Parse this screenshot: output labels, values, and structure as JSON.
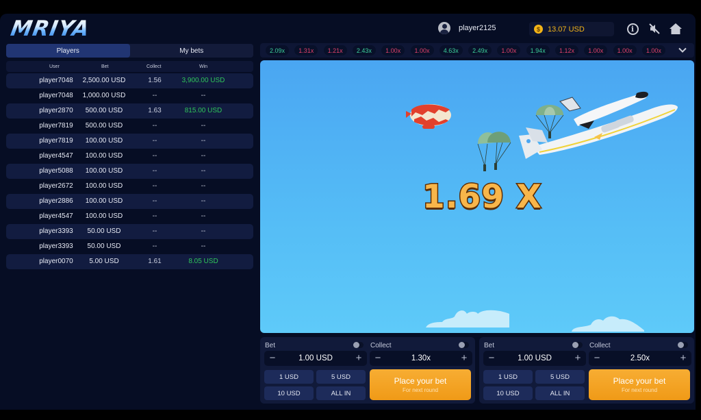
{
  "header": {
    "logo": "MRIYA",
    "username": "player2125",
    "balance": "13.07 USD",
    "icons": [
      "user-avatar-icon",
      "coin-icon",
      "info-icon",
      "sound-muted-icon",
      "home-icon"
    ]
  },
  "left_panel": {
    "tabs": [
      {
        "label": "Players",
        "active": true
      },
      {
        "label": "My bets",
        "active": false
      }
    ],
    "columns": [
      "User",
      "Bet",
      "Collect",
      "Win"
    ],
    "rows": [
      {
        "user": "player7048",
        "bet": "2,500.00 USD",
        "collect": "1.56",
        "win": "3,900.00 USD",
        "won": true
      },
      {
        "user": "player7048",
        "bet": "1,000.00 USD",
        "collect": "--",
        "win": "--",
        "won": false
      },
      {
        "user": "player2870",
        "bet": "500.00 USD",
        "collect": "1.63",
        "win": "815.00 USD",
        "won": true
      },
      {
        "user": "player7819",
        "bet": "500.00 USD",
        "collect": "--",
        "win": "--",
        "won": false
      },
      {
        "user": "player7819",
        "bet": "100.00 USD",
        "collect": "--",
        "win": "--",
        "won": false
      },
      {
        "user": "player4547",
        "bet": "100.00 USD",
        "collect": "--",
        "win": "--",
        "won": false
      },
      {
        "user": "player5088",
        "bet": "100.00 USD",
        "collect": "--",
        "win": "--",
        "won": false
      },
      {
        "user": "player2672",
        "bet": "100.00 USD",
        "collect": "--",
        "win": "--",
        "won": false
      },
      {
        "user": "player2886",
        "bet": "100.00 USD",
        "collect": "--",
        "win": "--",
        "won": false
      },
      {
        "user": "player4547",
        "bet": "100.00 USD",
        "collect": "--",
        "win": "--",
        "won": false
      },
      {
        "user": "player3393",
        "bet": "50.00 USD",
        "collect": "--",
        "win": "--",
        "won": false
      },
      {
        "user": "player3393",
        "bet": "50.00 USD",
        "collect": "--",
        "win": "--",
        "won": false
      },
      {
        "user": "player0070",
        "bet": "5.00 USD",
        "collect": "1.61",
        "win": "8.05 USD",
        "won": true
      }
    ]
  },
  "history": [
    {
      "value": "2.09x",
      "status": "green"
    },
    {
      "value": "1.31x",
      "status": "red"
    },
    {
      "value": "1.21x",
      "status": "red"
    },
    {
      "value": "2.43x",
      "status": "green"
    },
    {
      "value": "1.00x",
      "status": "red"
    },
    {
      "value": "1.00x",
      "status": "red"
    },
    {
      "value": "4.63x",
      "status": "green"
    },
    {
      "value": "2.49x",
      "status": "green"
    },
    {
      "value": "1.00x",
      "status": "red"
    },
    {
      "value": "1.94x",
      "status": "green"
    },
    {
      "value": "1.12x",
      "status": "red"
    },
    {
      "value": "1.00x",
      "status": "red"
    },
    {
      "value": "1.00x",
      "status": "red"
    },
    {
      "value": "1.00x",
      "status": "red"
    }
  ],
  "game": {
    "multiplier": "1.69 X",
    "scene_items": [
      "blimp",
      "parachutists",
      "mriya-plane-with-shuttle",
      "clouds"
    ]
  },
  "bet_panels": [
    {
      "bet_label": "Bet",
      "collect_label": "Collect",
      "bet_value": "1.00 USD",
      "collect_value": "1.30x",
      "quick_bets": [
        "1 USD",
        "5 USD",
        "10 USD",
        "ALL IN"
      ],
      "place_label": "Place your bet",
      "place_sub": "For next round",
      "minus": "−",
      "plus": "+"
    },
    {
      "bet_label": "Bet",
      "collect_label": "Collect",
      "bet_value": "1.00 USD",
      "collect_value": "2.50x",
      "quick_bets": [
        "1 USD",
        "5 USD",
        "10 USD",
        "ALL IN"
      ],
      "place_label": "Place your bet",
      "place_sub": "For next round",
      "minus": "−",
      "plus": "+"
    }
  ],
  "colors": {
    "background": "#060d24",
    "accent_orange": "#f09a17",
    "win_green": "#2fc55a",
    "history_green": "#3ccf9b",
    "history_red": "#e0416a",
    "balance_gold": "#f3b417",
    "sky": "#4aa6f2"
  }
}
